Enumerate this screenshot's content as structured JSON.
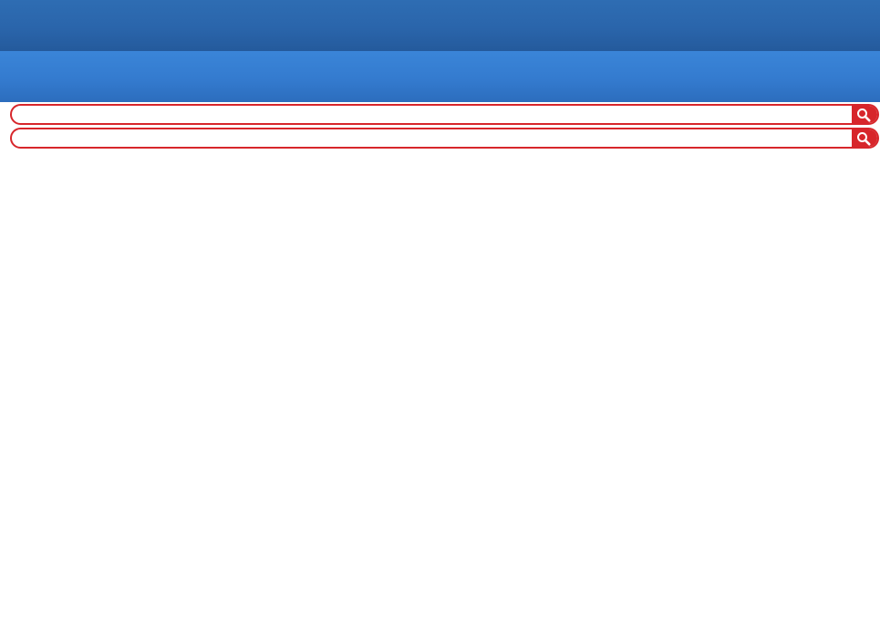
{
  "header": {
    "top_bar_color": "#2a65ab",
    "sub_bar_color": "#347bcf"
  },
  "search": {
    "accent_color": "#d7262b",
    "fields": [
      {
        "value": "",
        "placeholder": "",
        "button_icon": "search-icon"
      },
      {
        "value": "",
        "placeholder": "",
        "button_icon": "search-icon"
      }
    ]
  }
}
